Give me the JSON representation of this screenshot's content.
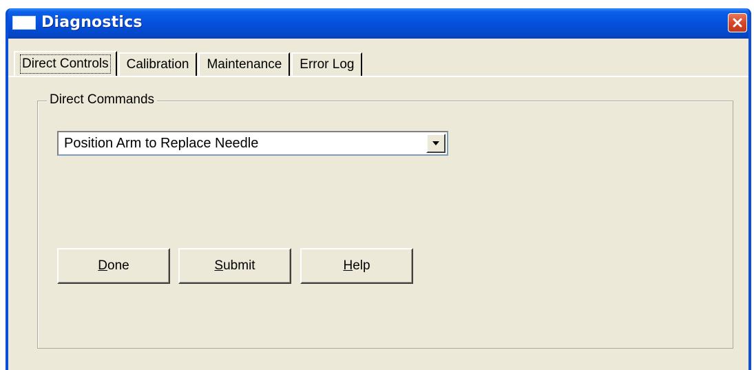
{
  "window": {
    "title": "Diagnostics",
    "icon": "window-icon",
    "close_icon": "close-icon",
    "colors": {
      "titlebar": "#0550dc",
      "frame": "#0b4fd6",
      "face": "#ece9d8",
      "close": "#d4472c"
    }
  },
  "tabs": [
    {
      "label": "Direct Controls",
      "active": true
    },
    {
      "label": "Calibration",
      "active": false
    },
    {
      "label": "Maintenance",
      "active": false
    },
    {
      "label": "Error Log",
      "active": false
    }
  ],
  "direct_commands": {
    "group_title": "Direct Commands",
    "selected_command": "Position Arm to Replace Needle",
    "dropdown_icon": "chevron-down-icon"
  },
  "buttons": {
    "done": {
      "accel": "D",
      "rest": "one"
    },
    "submit": {
      "accel": "S",
      "rest": "ubmit"
    },
    "help": {
      "accel": "H",
      "rest": "elp"
    }
  }
}
